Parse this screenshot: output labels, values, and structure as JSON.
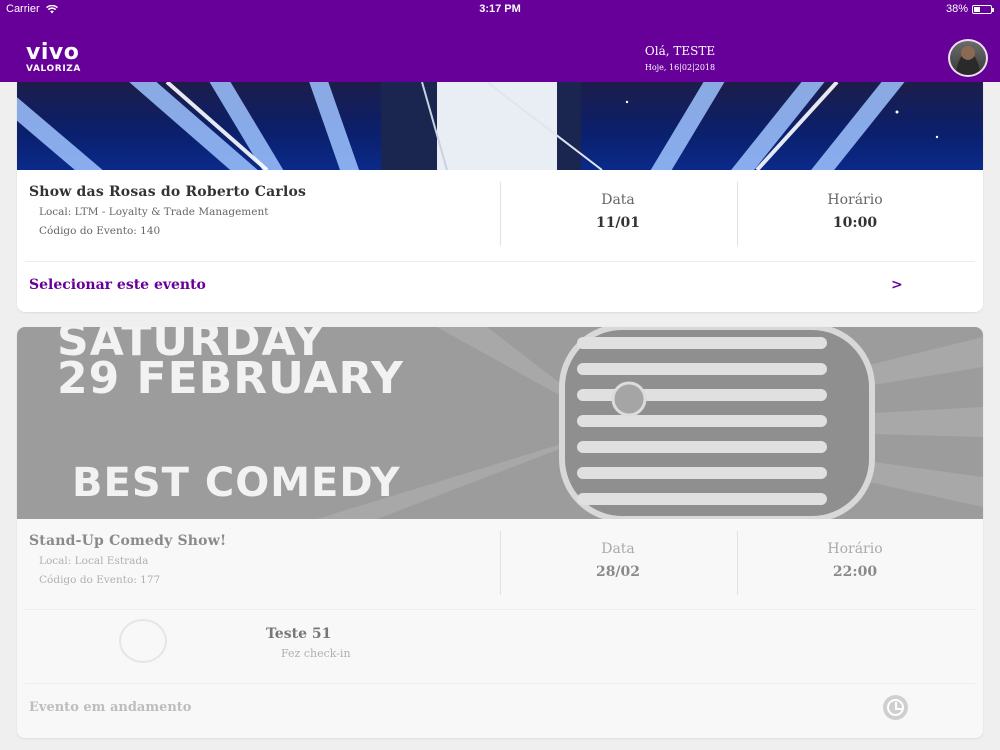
{
  "status_bar": {
    "carrier": "Carrier",
    "time": "3:17 PM",
    "battery": "38%",
    "battery_level": 0.38
  },
  "header": {
    "logo_line1": "vivo",
    "logo_line2": "VALORIZA",
    "greeting": "Olá, TESTE",
    "date": "Hoje, 16|02|2018"
  },
  "events": [
    {
      "title": "Show das Rosas do Roberto Carlos",
      "local": "Local: LTM - Loyalty & Trade Management",
      "code": "Código do Evento: 140",
      "date_label": "Data",
      "date": "11/01",
      "time_label": "Horário",
      "time": "10:00",
      "action": "Selecionar este evento",
      "action_arrow": ">"
    },
    {
      "banner_text1": "SATURDAY",
      "banner_text2": "29 FEBRUARY",
      "banner_text3": "BEST COMEDY",
      "title": "Stand-Up Comedy Show!",
      "local": "Local: Local Estrada",
      "code": "Código do Evento: 177",
      "date_label": "Data",
      "date": "28/02",
      "time_label": "Horário",
      "time": "22:00",
      "participant": "Teste 51",
      "participant_status": "Fez check-in",
      "progress": "Evento em andamento"
    }
  ],
  "colors": {
    "brand": "#660099"
  }
}
